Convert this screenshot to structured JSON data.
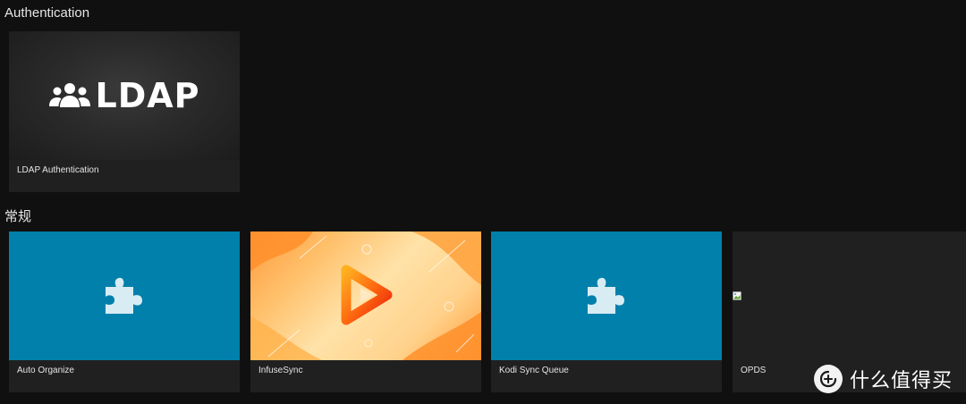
{
  "sections": {
    "authentication": {
      "title": "Authentication",
      "cards": [
        {
          "label": "LDAP Authentication",
          "logo_text": "LDAP",
          "icon": "users-group-icon"
        }
      ]
    },
    "general": {
      "title": "常规",
      "cards": [
        {
          "label": "Auto Organize",
          "icon": "puzzle-piece-icon"
        },
        {
          "label": "InfuseSync",
          "icon": "infuse-play-logo-icon"
        },
        {
          "label": "Kodi Sync Queue",
          "icon": "puzzle-piece-icon"
        },
        {
          "label": "OPDS",
          "icon": "broken-image-icon"
        }
      ]
    }
  },
  "watermark": {
    "text": "什么值得买",
    "logo": "smzdm-logo"
  },
  "colors": {
    "background": "#101010",
    "card": "#202020",
    "plugin_blue": "#0180ab",
    "puzzle": "#d8ecf4",
    "infuse_orange": "#ff8a1f"
  }
}
